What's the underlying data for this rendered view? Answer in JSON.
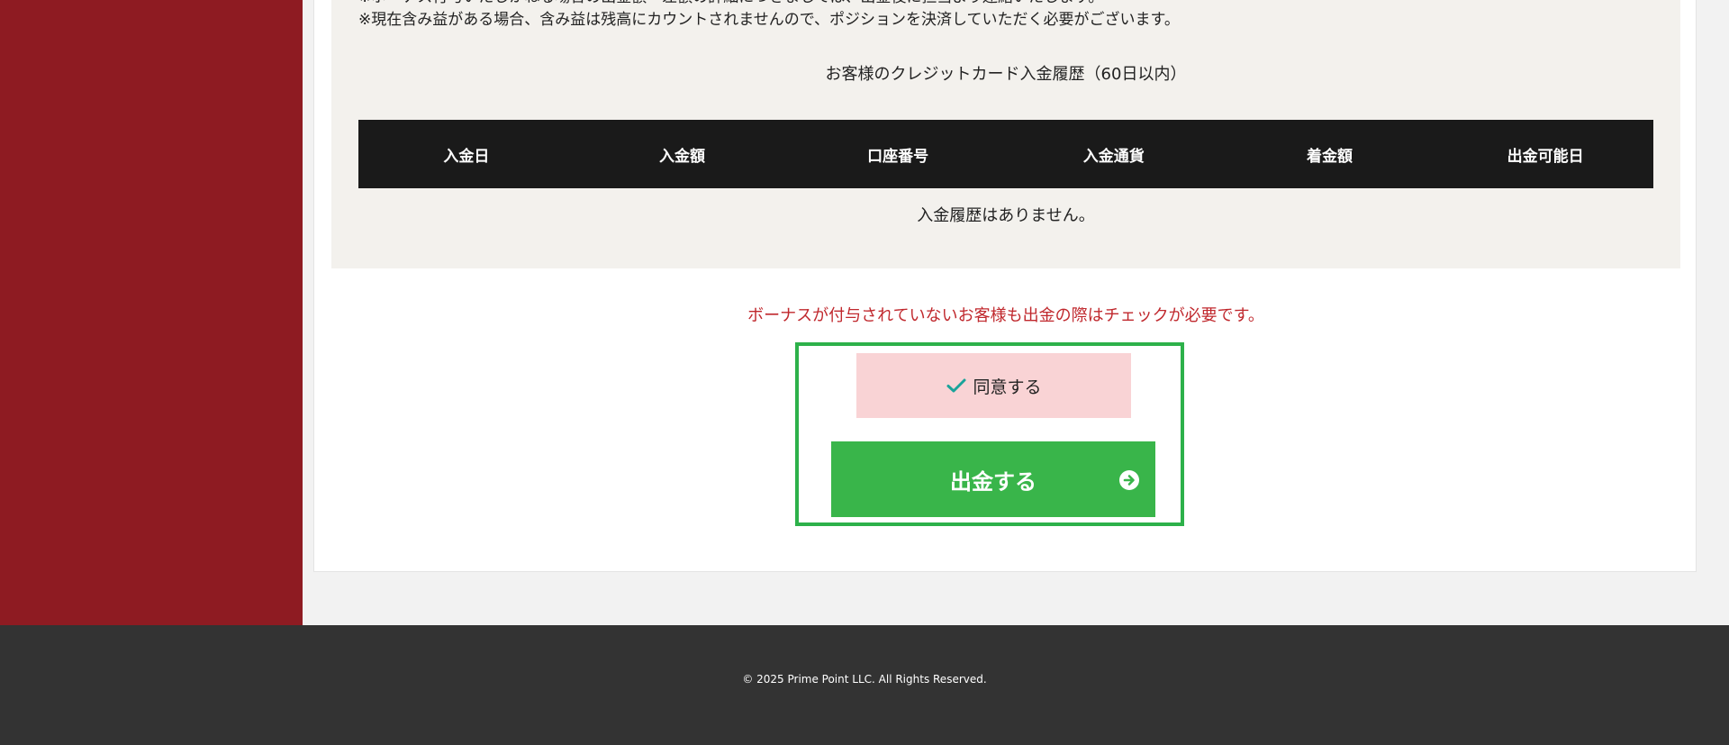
{
  "colors": {
    "sidebar": "#8e1b22",
    "panel": "#f3f1ed",
    "table_header": "#1a1a1a",
    "warning": "#c0282d",
    "agree_bg": "#f9d3d5",
    "check": "#1aa39a",
    "button": "#39b54a",
    "footer_bg": "#333333",
    "footer_text": "#ffffff"
  },
  "notes": {
    "cut_line": "※ボーナス付与いたしかねる場合の出金額・差額の詳細につきましては、出金後に担当より連絡いたします。",
    "unrealized_profit": "※現在含み益がある場合、含み益は残高にカウントされませんので、ポジションを決済していただく必要がございます。"
  },
  "history": {
    "title": "お客様のクレジットカード入金履歴（60日以内）",
    "columns": [
      "入金日",
      "入金額",
      "口座番号",
      "入金通貨",
      "着金額",
      "出金可能日"
    ],
    "empty_message": "入金履歴はありません。"
  },
  "warning": "ボーナスが付与されていないお客様も出金の際はチェックが必要です。",
  "agree": {
    "label": "同意する",
    "icon": "check-icon"
  },
  "withdraw_button": {
    "label": "出金する",
    "icon": "arrow-circle-right-icon"
  },
  "footer": {
    "copyright": "© 2025 Prime Point LLC. All Rights Reserved."
  }
}
